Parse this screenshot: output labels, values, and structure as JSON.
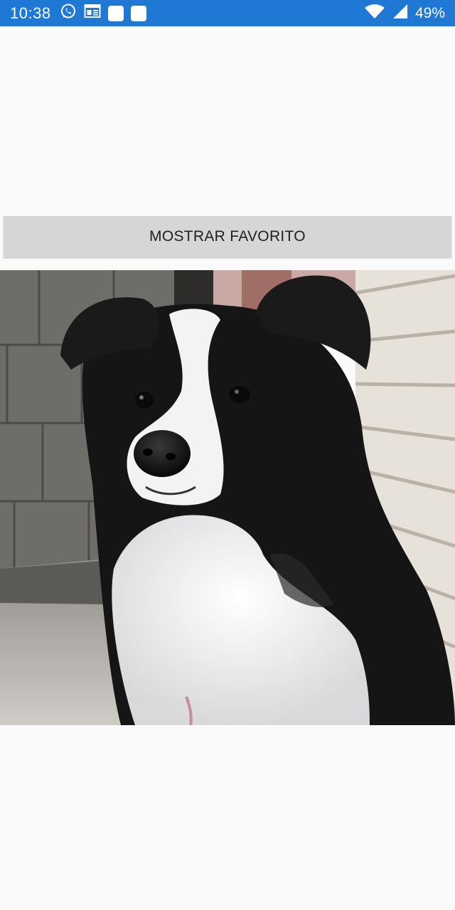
{
  "status_bar": {
    "time": "10:38",
    "battery": "49%",
    "background_color": "#1e78d4",
    "icons_left": [
      "whatsapp-icon",
      "news-icon",
      "app-icon",
      "app-icon"
    ],
    "icons_right": [
      "wifi-icon",
      "cellular-signal-icon"
    ]
  },
  "main": {
    "button_label": "MOSTRAR FAVORITO",
    "image": {
      "subject": "dog-photo"
    }
  }
}
